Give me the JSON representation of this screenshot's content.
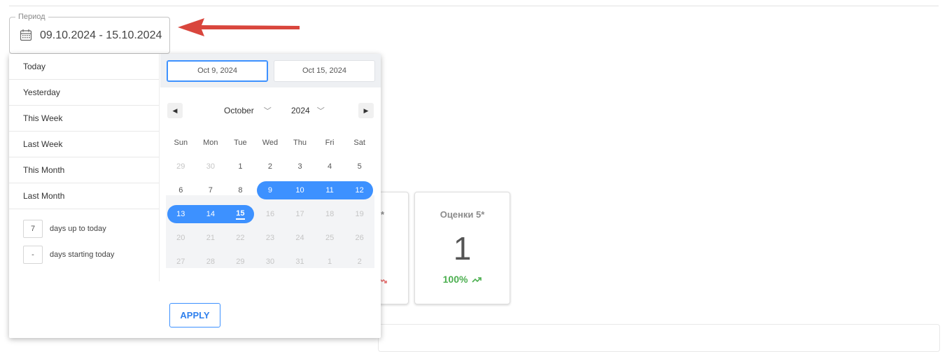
{
  "period": {
    "legend": "Период",
    "value": "09.10.2024 - 15.10.2024"
  },
  "kpi_cards": [
    {
      "title": "*",
      "delta": ""
    },
    {
      "title": "Оценки 5*",
      "value": "1",
      "delta": "100%"
    }
  ],
  "colors": {
    "accent": "#3d91ff",
    "positive": "#4caf50",
    "negative": "#e57373",
    "annotation_arrow": "#d9463d"
  },
  "date_picker": {
    "start_date": "Oct 9, 2024",
    "end_date": "Oct 15, 2024",
    "month": "October",
    "year": "2024",
    "prev_icon": "triangle-left-icon",
    "next_icon": "triangle-right-icon",
    "weekdays": [
      "Sun",
      "Mon",
      "Tue",
      "Wed",
      "Thu",
      "Fri",
      "Sat"
    ],
    "weeks": [
      [
        "29",
        "30",
        "1",
        "2",
        "3",
        "4",
        "5"
      ],
      [
        "6",
        "7",
        "8",
        "9",
        "10",
        "11",
        "12"
      ],
      [
        "13",
        "14",
        "15",
        "16",
        "17",
        "18",
        "19"
      ],
      [
        "20",
        "21",
        "22",
        "23",
        "24",
        "25",
        "26"
      ],
      [
        "27",
        "28",
        "29",
        "30",
        "31",
        "1",
        "2"
      ]
    ],
    "static_ranges": [
      "Today",
      "Yesterday",
      "This Week",
      "Last Week",
      "This Month",
      "Last Month"
    ],
    "input_ranges": [
      {
        "value": "7",
        "label": "days up to today"
      },
      {
        "value": "-",
        "label": "days starting today"
      }
    ],
    "apply_label": "APPLY"
  }
}
